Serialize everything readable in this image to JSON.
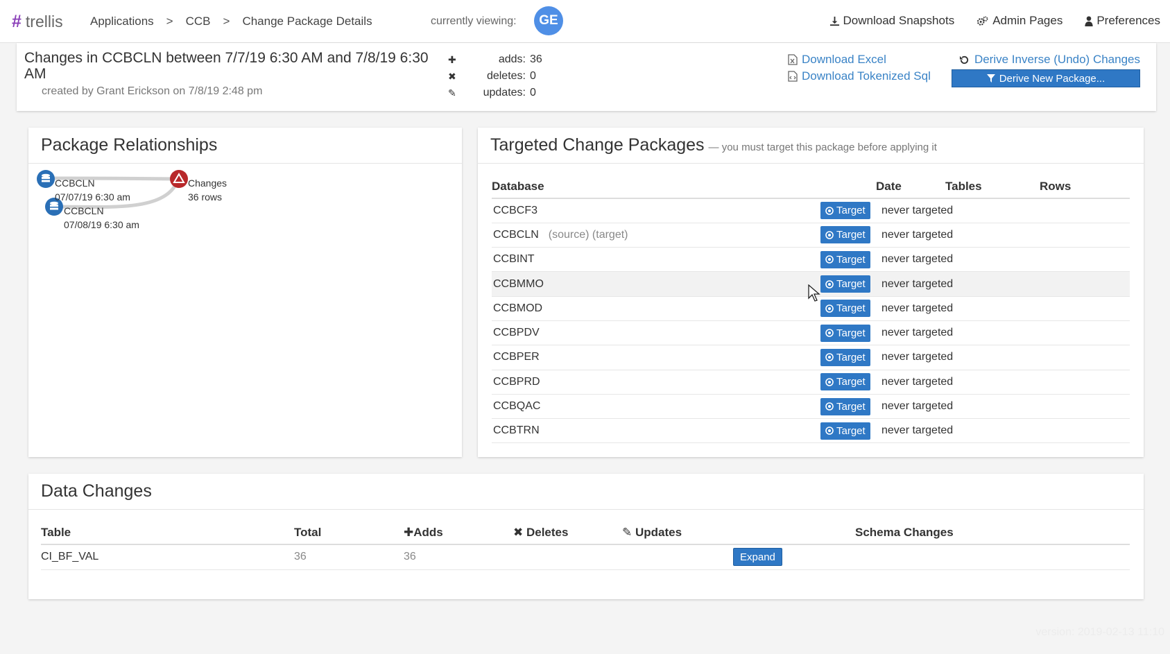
{
  "nav": {
    "logo_text": "trellis",
    "breadcrumbs": [
      "Applications",
      "CCB",
      "Change Package Details"
    ],
    "viewing_label": "currently viewing:",
    "avatar_initials": "GE",
    "links": {
      "download_snapshots": "Download Snapshots",
      "admin_pages": "Admin Pages",
      "preferences": "Preferences"
    }
  },
  "header": {
    "title": "Changes in CCBCLN between 7/7/19 6:30 AM and 7/8/19 6:30 AM",
    "created": "created by Grant Erickson on 7/8/19 2:48 pm",
    "stats": [
      {
        "icon": "plus-icon",
        "label": "adds:",
        "value": "36"
      },
      {
        "icon": "x-icon",
        "label": "deletes:",
        "value": "0"
      },
      {
        "icon": "pencil-icon",
        "label": "updates:",
        "value": "0"
      }
    ],
    "download_excel": "Download Excel",
    "download_sql": "Download Tokenized Sql",
    "derive_inverse": "Derive Inverse (Undo) Changes",
    "derive_new": "Derive New Package..."
  },
  "relationships": {
    "title": "Package Relationships",
    "nodes": [
      {
        "name": "CCBCLN",
        "date": "07/07/19 6:30 am"
      },
      {
        "name": "CCBCLN",
        "date": "07/08/19 6:30 am"
      },
      {
        "name": "Changes",
        "date": "36 rows"
      }
    ]
  },
  "targeted": {
    "title": "Targeted Change Packages",
    "subtitle": "— you must target this package before applying it",
    "columns": [
      "Database",
      "Date",
      "Tables",
      "Rows"
    ],
    "target_label": "Target",
    "never_label": "never targeted",
    "rows": [
      {
        "db": "CCBCF3",
        "note": ""
      },
      {
        "db": "CCBCLN",
        "note": "(source) (target)"
      },
      {
        "db": "CCBINT",
        "note": ""
      },
      {
        "db": "CCBMMO",
        "note": ""
      },
      {
        "db": "CCBMOD",
        "note": ""
      },
      {
        "db": "CCBPDV",
        "note": ""
      },
      {
        "db": "CCBPER",
        "note": ""
      },
      {
        "db": "CCBPRD",
        "note": ""
      },
      {
        "db": "CCBQAC",
        "note": ""
      },
      {
        "db": "CCBTRN",
        "note": ""
      }
    ]
  },
  "data_changes": {
    "title": "Data Changes",
    "columns": {
      "table": "Table",
      "total": "Total",
      "adds": "Adds",
      "deletes": "Deletes",
      "updates": "Updates",
      "schema": "Schema Changes"
    },
    "rows": [
      {
        "table": "CI_BF_VAL",
        "total": "36",
        "adds": "36",
        "deletes": "",
        "updates": "",
        "action": "Expand"
      }
    ]
  },
  "footer": {
    "version": "version: 2019-02-13 11:10"
  },
  "colors": {
    "accent": "#2f78c5",
    "link": "#3a83c6",
    "brand": "#8a3fb8",
    "avatar": "#4f8fe6"
  }
}
